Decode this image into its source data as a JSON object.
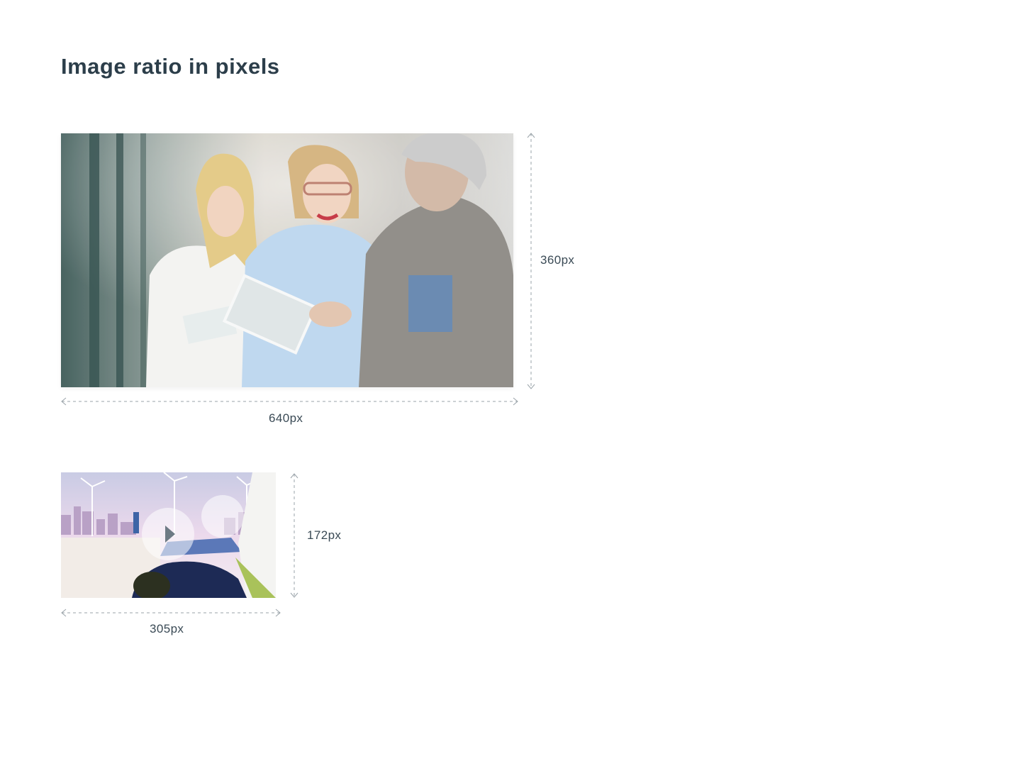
{
  "title": "Image ratio in pixels",
  "images": {
    "large": {
      "width_label": "640px",
      "height_label": "360px",
      "subject": "three colleagues reviewing a tablet in an office"
    },
    "small": {
      "width_label": "305px",
      "height_label": "172px",
      "subject": "city skyline with wind turbines, solar panels and electric car charging",
      "overlay_icon": "play-icon"
    }
  },
  "colors": {
    "title": "#2c3e4a",
    "dimension_line": "#9aa3a9",
    "accent_green": "#a9c25a"
  }
}
